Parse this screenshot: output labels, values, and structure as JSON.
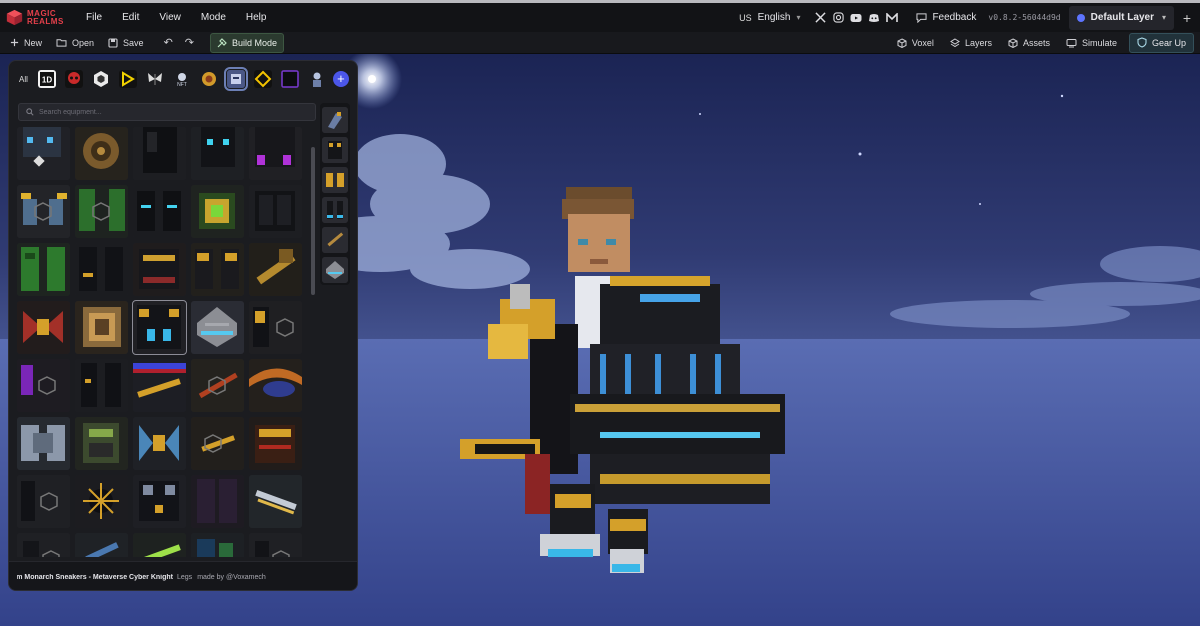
{
  "app": {
    "logo_line1": "MAGIC",
    "logo_line2": "REALMS"
  },
  "menu": {
    "items": [
      "File",
      "Edit",
      "View",
      "Mode",
      "Help"
    ]
  },
  "language": {
    "flag": "US",
    "label": "English"
  },
  "socials": [
    "x-icon",
    "instagram-icon",
    "youtube-icon",
    "discord-icon",
    "medium-icon"
  ],
  "feedback_label": "Feedback",
  "version": "v0.8.2-56044d9d",
  "layer": {
    "label": "Default Layer",
    "color": "#5d74ff"
  },
  "toolbar": {
    "new_label": "New",
    "open_label": "Open",
    "save_label": "Save",
    "build_mode_label": "Build Mode",
    "voxel_label": "Voxel",
    "layers_label": "Layers",
    "assets_label": "Assets",
    "simulate_label": "Simulate",
    "gear_up_label": "Gear Up"
  },
  "panel": {
    "all_label": "All",
    "search_placeholder": "Search equipment...",
    "collections": [
      "1D",
      "Skull",
      "Hex",
      "Bolt",
      "Butterfly",
      "NFT",
      "Orb",
      "Mech",
      "Cube",
      "Frame",
      "Warrior"
    ],
    "footer": {
      "item_name": "Quantum Monarch Sneakers - Metaverse Cyber Knight",
      "category": "Legs",
      "author": "made by @Voxamech"
    }
  },
  "colors": {
    "accent": "#4b56e8",
    "brand": "#e5404b",
    "build_mode_bg": "#2b3a2f"
  }
}
